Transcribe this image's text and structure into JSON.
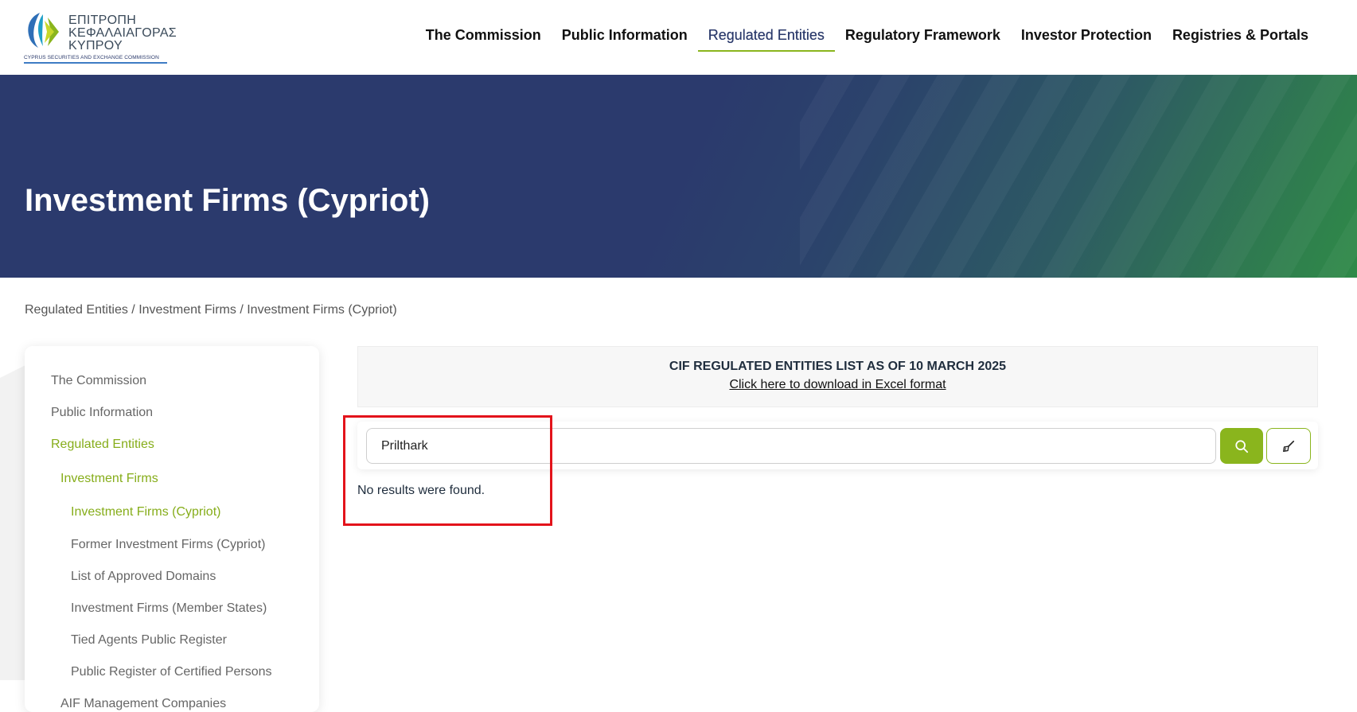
{
  "header": {
    "logo": {
      "line1": "ΕΠΙΤΡΟΠΗ",
      "line2": "ΚΕΦΑΛΑΙΑΓΟΡΑΣ",
      "line3": "ΚΥΠΡΟΥ",
      "subtitle": "CYPRUS SECURITIES AND EXCHANGE COMMISSION"
    },
    "nav": [
      {
        "label": "The Commission"
      },
      {
        "label": "Public Information"
      },
      {
        "label": "Regulated Entities"
      },
      {
        "label": "Regulatory Framework"
      },
      {
        "label": "Investor Protection"
      },
      {
        "label": "Registries & Portals"
      }
    ]
  },
  "hero": {
    "title": "Investment Firms (Cypriot)"
  },
  "breadcrumb": "Regulated Entities / Investment Firms / Investment Firms (Cypriot)",
  "sidebar": {
    "items": [
      {
        "label": "The Commission"
      },
      {
        "label": "Public Information"
      },
      {
        "label": "Regulated Entities"
      },
      {
        "label": "Investment Firms"
      },
      {
        "label": "Investment Firms (Cypriot)"
      },
      {
        "label": "Former Investment Firms (Cypriot)"
      },
      {
        "label": "List of Approved Domains"
      },
      {
        "label": "Investment Firms (Member States)"
      },
      {
        "label": "Tied Agents Public Register"
      },
      {
        "label": "Public Register of Certified Persons"
      },
      {
        "label": "AIF Management Companies"
      }
    ]
  },
  "notice": {
    "title": "CIF REGULATED ENTITIES LIST AS OF 10 MARCH 2025",
    "link": "Click here to download in Excel format"
  },
  "search": {
    "value": "Prilthark"
  },
  "results": {
    "message": "No results were found."
  },
  "colors": {
    "accent": "#8ab51d",
    "navy": "#2b3a6d",
    "highlight": "#e3131b"
  }
}
